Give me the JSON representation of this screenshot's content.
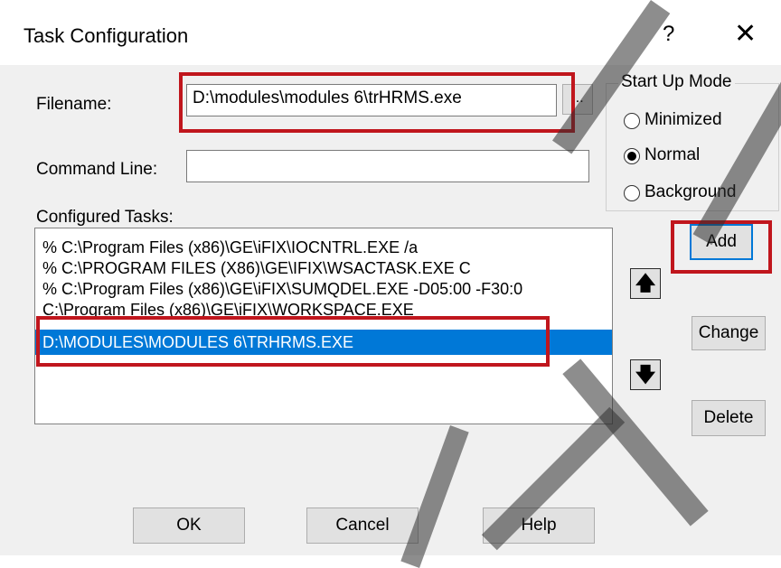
{
  "dialog": {
    "title": "Task Configuration",
    "help_glyph": "?",
    "close_glyph": "✕"
  },
  "form": {
    "filename_label": "Filename:",
    "filename_value": "D:\\modules\\modules 6\\trHRMS.exe",
    "browse_label": "...",
    "command_line_label": "Command Line:",
    "command_line_value": ""
  },
  "startup_mode": {
    "label": "Start Up Mode",
    "options": [
      {
        "label": "Minimized",
        "checked": false
      },
      {
        "label": "Normal",
        "checked": true
      },
      {
        "label": "Background",
        "checked": false
      }
    ]
  },
  "tasks": {
    "label": "Configured Tasks:",
    "rows": [
      "% C:\\Program Files (x86)\\GE\\iFIX\\IOCNTRL.EXE  /a",
      "% C:\\PROGRAM FILES (X86)\\GE\\IFIX\\WSACTASK.EXE  C",
      "% C:\\Program Files (x86)\\GE\\iFIX\\SUMQDEL.EXE  -D05:00 -F30:0",
      "C:\\Program Files (x86)\\GE\\iFIX\\WORKSPACE.EXE",
      "D:\\MODULES\\MODULES 6\\TRHRMS.EXE"
    ],
    "selected_index": 4
  },
  "buttons": {
    "add": "Add",
    "change": "Change",
    "delete": "Delete",
    "ok": "OK",
    "cancel": "Cancel",
    "help": "Help",
    "move_up": "🡅",
    "move_down": "🡇"
  },
  "colors": {
    "highlight_red": "#c0161d",
    "selection_blue": "#0078d7"
  }
}
